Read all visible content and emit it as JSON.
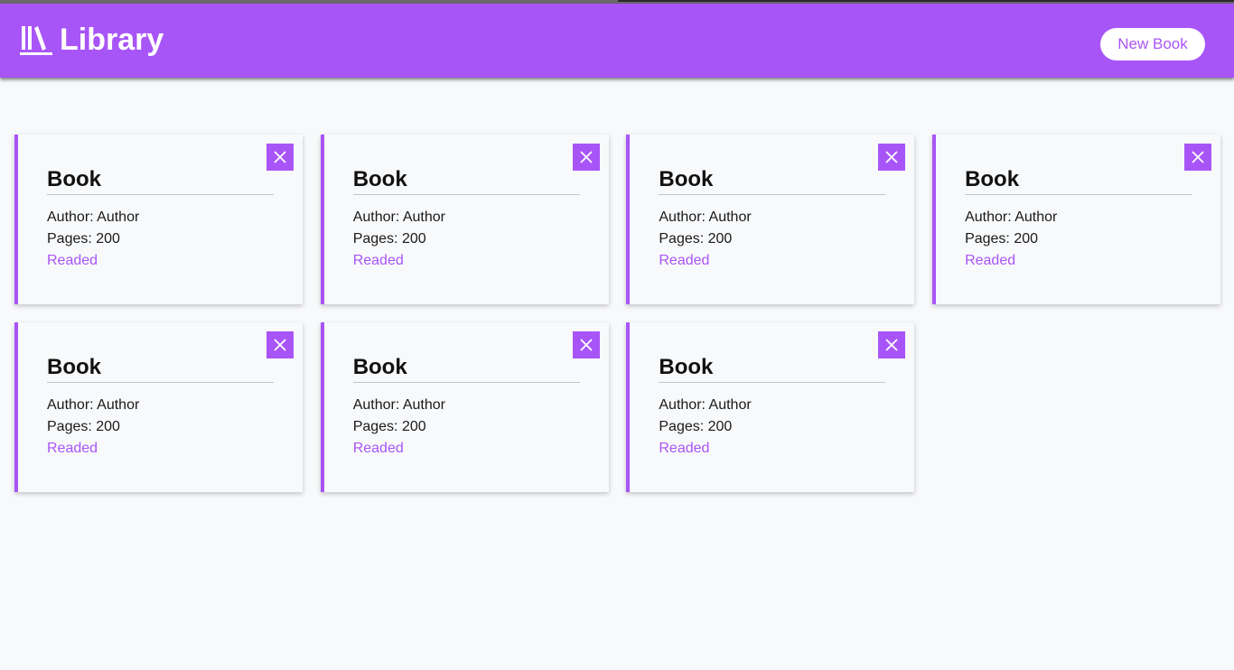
{
  "header": {
    "title": "Library",
    "logo_icon": "library-books-icon",
    "new_book_label": "New Book"
  },
  "colors": {
    "accent": "#a855f7",
    "background": "#f8f9fb",
    "text": "#111111"
  },
  "books": [
    {
      "title": "Book",
      "author_line": "Author: Author",
      "pages_line": "Pages: 200",
      "status": "Readed",
      "close_icon": "close-icon"
    },
    {
      "title": "Book",
      "author_line": "Author: Author",
      "pages_line": "Pages: 200",
      "status": "Readed",
      "close_icon": "close-icon"
    },
    {
      "title": "Book",
      "author_line": "Author: Author",
      "pages_line": "Pages: 200",
      "status": "Readed",
      "close_icon": "close-icon"
    },
    {
      "title": "Book",
      "author_line": "Author: Author",
      "pages_line": "Pages: 200",
      "status": "Readed",
      "close_icon": "close-icon"
    },
    {
      "title": "Book",
      "author_line": "Author: Author",
      "pages_line": "Pages: 200",
      "status": "Readed",
      "close_icon": "close-icon"
    },
    {
      "title": "Book",
      "author_line": "Author: Author",
      "pages_line": "Pages: 200",
      "status": "Readed",
      "close_icon": "close-icon"
    },
    {
      "title": "Book",
      "author_line": "Author: Author",
      "pages_line": "Pages: 200",
      "status": "Readed",
      "close_icon": "close-icon"
    }
  ]
}
